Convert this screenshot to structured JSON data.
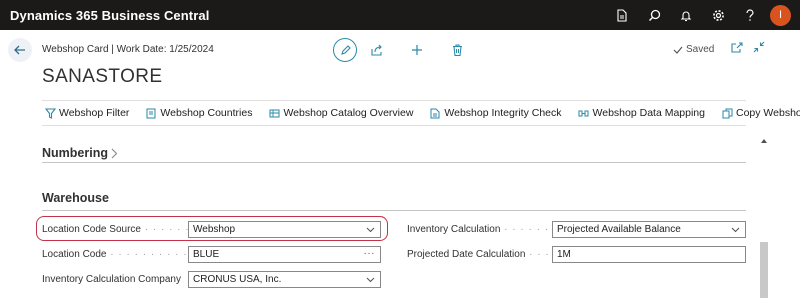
{
  "app": {
    "title": "Dynamics 365 Business Central",
    "avatar_initial": "I",
    "top_icons": [
      "document-icon",
      "search-icon",
      "bell-icon",
      "gear-icon",
      "help-icon"
    ]
  },
  "header": {
    "breadcrumb": "Webshop Card | Work Date: 1/25/2024",
    "title": "SANASTORE",
    "saved_label": "Saved"
  },
  "actions": [
    {
      "label": "Webshop Filter",
      "icon": "filter-icon"
    },
    {
      "label": "Webshop Countries",
      "icon": "countries-icon"
    },
    {
      "label": "Webshop Catalog Overview",
      "icon": "catalog-icon"
    },
    {
      "label": "Webshop Integrity Check",
      "icon": "document-check-icon"
    },
    {
      "label": "Webshop Data Mapping",
      "icon": "data-mapping-icon"
    },
    {
      "label": "Copy Webshop",
      "icon": "copy-icon"
    }
  ],
  "more_label": "···",
  "sections": {
    "numbering": "Numbering",
    "warehouse": "Warehouse"
  },
  "fields": {
    "location_code_source": {
      "label": "Location Code Source",
      "value": "Webshop"
    },
    "location_code": {
      "label": "Location Code",
      "value": "BLUE"
    },
    "inventory_calc_company": {
      "label": "Inventory Calculation Company",
      "value": "CRONUS USA, Inc."
    },
    "inventory_calculation": {
      "label": "Inventory Calculation",
      "value": "Projected Available Balance"
    },
    "projected_date_calc": {
      "label": "Projected Date Calculation",
      "value": "1M"
    }
  },
  "colors": {
    "topbar": "#1b1a19",
    "accent": "#2a8aa8",
    "avatar": "#d9531e",
    "highlight": "#c4314b"
  }
}
